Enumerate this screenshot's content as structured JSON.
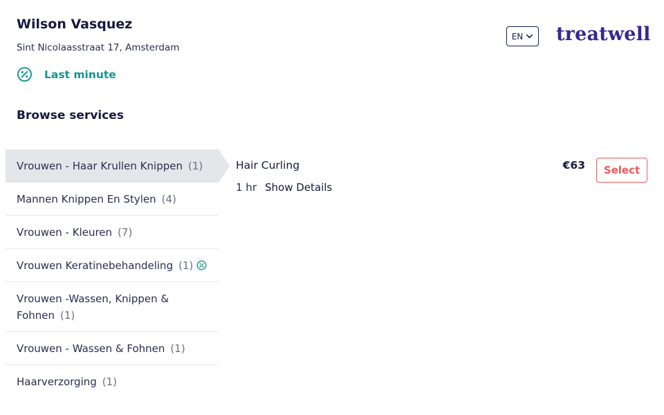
{
  "venue": {
    "name": "Wilson Vasquez",
    "address": "Sint Nicolaasstraat 17, Amsterdam",
    "last_minute_label": "Last minute"
  },
  "header": {
    "language": "EN",
    "logo_text": "treatwell"
  },
  "browse": {
    "heading": "Browse services"
  },
  "categories": [
    {
      "label": "Vrouwen - Haar Krullen Knippen",
      "count": "(1)",
      "active": true
    },
    {
      "label": "Mannen Knippen En Stylen",
      "count": "(4)"
    },
    {
      "label": "Vrouwen - Kleuren",
      "count": "(7)"
    },
    {
      "label": "Vrouwen Keratinebehandeling",
      "count": "(1)",
      "last_minute_badge": true
    },
    {
      "label": "Vrouwen -Wassen, Knippen & Fohnen",
      "count": "(1)"
    },
    {
      "label": "Vrouwen - Wassen & Fohnen",
      "count": "(1)"
    },
    {
      "label": "Haarverzorging",
      "count": "(1)"
    }
  ],
  "service": {
    "name": "Hair Curling",
    "duration": "1 hr",
    "details_link": "Show Details",
    "price": "€63",
    "select_label": "Select"
  },
  "colors": {
    "accent_teal": "#12978f",
    "select_red": "#ef5b5b",
    "brand_purple": "#332a8c",
    "active_bg": "#e5e6ea"
  },
  "icons": {
    "last_minute": "percent-badge-icon",
    "language_caret": "chevron-down-icon"
  }
}
